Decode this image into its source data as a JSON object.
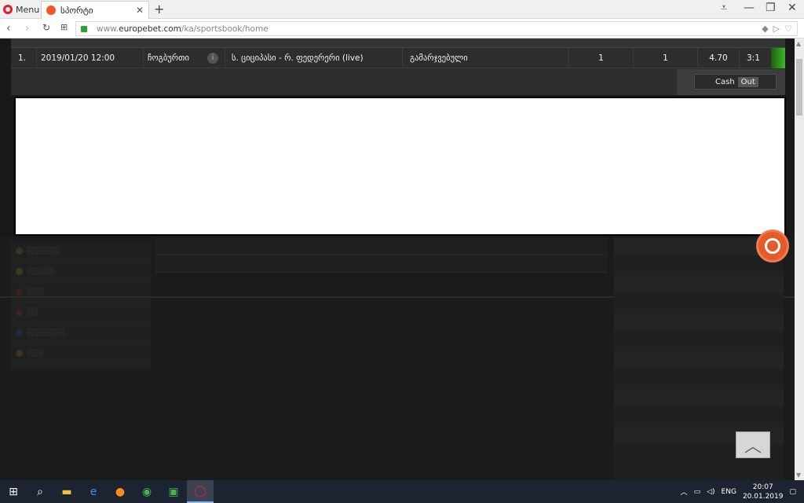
{
  "browser": {
    "menu_label": "Menu",
    "tab_title": "სპორტი",
    "url_prefix": "www.",
    "url_host": "europebet.com",
    "url_path": "/ka/sportsbook/home"
  },
  "bet_row": {
    "num": "1.",
    "date": "2019/01/20 12:00",
    "sport": "ჩოგბურთი",
    "match": "ს. ციციპასი - რ. ფედერერი (live)",
    "market": "გამარჯვებული",
    "v1": "1",
    "v2": "1",
    "v3": "4.70",
    "v4": "3:1"
  },
  "cashout": {
    "cash": "Cash",
    "out": "Out"
  },
  "colors": {
    "accent_green": "#3cb82a",
    "fab_orange": "#e45a2a"
  },
  "taskbar": {
    "lang": "ENG",
    "time": "20:07",
    "date": "20.01.2019"
  }
}
